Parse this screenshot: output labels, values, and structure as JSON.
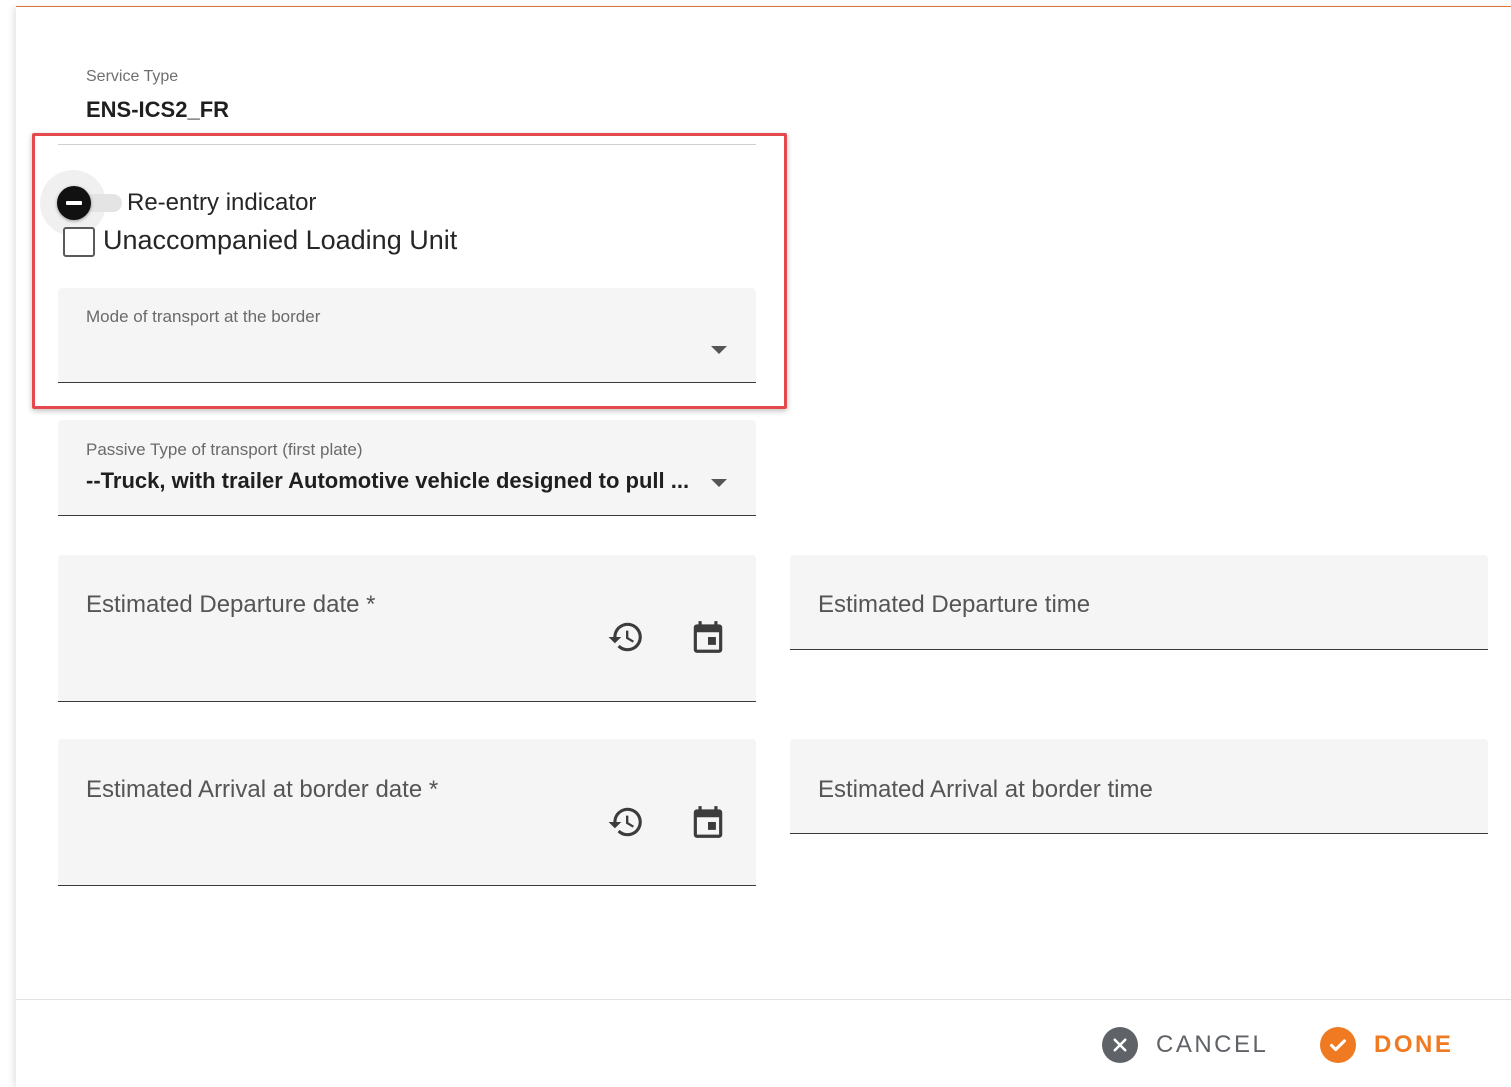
{
  "service_type": {
    "label": "Service Type",
    "value": "ENS-ICS2_FR"
  },
  "reentry_toggle": {
    "label": "Re-entry indicator",
    "state": "indeterminate"
  },
  "unaccompanied_checkbox": {
    "label": "Unaccompanied Loading Unit",
    "checked": false
  },
  "mode_of_transport": {
    "label": "Mode of transport at the border",
    "value": ""
  },
  "passive_type": {
    "label": "Passive Type of transport (first plate)",
    "value": "--Truck, with trailer Automotive vehicle designed to pull ..."
  },
  "est_departure_date": {
    "placeholder": "Estimated Departure date *"
  },
  "est_departure_time": {
    "placeholder": "Estimated Departure time"
  },
  "est_arrival_date": {
    "placeholder": "Estimated Arrival at border date *"
  },
  "est_arrival_time": {
    "placeholder": "Estimated Arrival at border time"
  },
  "footer": {
    "cancel_label": "CANCEL",
    "done_label": "DONE"
  },
  "colors": {
    "accent": "#f07a22",
    "highlight_border": "#e5484d",
    "field_background": "#f5f5f5"
  }
}
